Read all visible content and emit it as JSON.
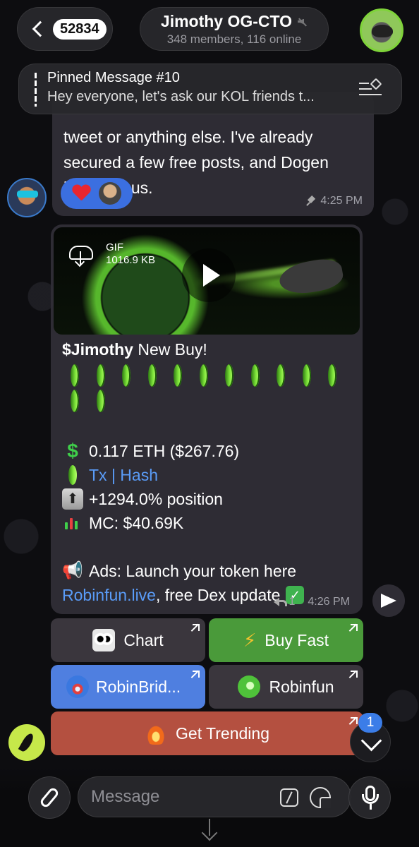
{
  "header": {
    "back_count": "52834",
    "title": "Jimothy OG-CTO",
    "subtitle": "348 members, 116 online"
  },
  "pinned": {
    "title": "Pinned Message #10",
    "preview": "Hey everyone, let's ask our KOL friends t..."
  },
  "messages": [
    {
      "text_lines": [
        "tweet or anything else. I've already",
        "secured a few free posts, and Dogen",
        "is joining us."
      ],
      "time": "4:25 PM"
    },
    {
      "gif": {
        "label": "GIF",
        "size": "1016.9 KB"
      },
      "title_token": "$Jimothy",
      "title_rest": "New Buy!",
      "coin_count": 13,
      "eth_line": "0.117 ETH ($267.76)",
      "tx_link": "Tx | Hash",
      "position_line": "+1294.0% position",
      "mc_line": "MC: $40.69K",
      "ads_line": "Ads: Launch your token here",
      "ads_link": "Robinfun.live",
      "ads_suffix": ", free Dex update",
      "reply_count": "1",
      "time": "4:26 PM"
    }
  ],
  "buttons": {
    "chart": "Chart",
    "buy_fast": "Buy Fast",
    "robinbridge": "RobinBrid...",
    "robinfun": "Robinfun",
    "get_trending": "Get Trending"
  },
  "scroll_badge": "1",
  "composer": {
    "placeholder": "Message"
  },
  "colors": {
    "accent_blue": "#3b7de8",
    "link": "#5a9cf8",
    "buy_green": "#4a9a3a",
    "trending_red": "#b45040",
    "bridge_blue": "#4f7fe0"
  },
  "icons": [
    "back-chevron-icon",
    "mute-icon",
    "pin-list-icon",
    "heart-icon",
    "download-icon",
    "play-icon",
    "dollar-icon",
    "coin-icon",
    "up-arrow-icon",
    "chart-icon",
    "megaphone-icon",
    "check-icon",
    "reply-icon",
    "share-icon",
    "owl-icon",
    "bolt-icon",
    "bridge-icon",
    "leaf-icon",
    "fire-icon",
    "chevron-down-icon",
    "paperclip-icon",
    "command-icon",
    "sticker-icon",
    "microphone-icon"
  ]
}
